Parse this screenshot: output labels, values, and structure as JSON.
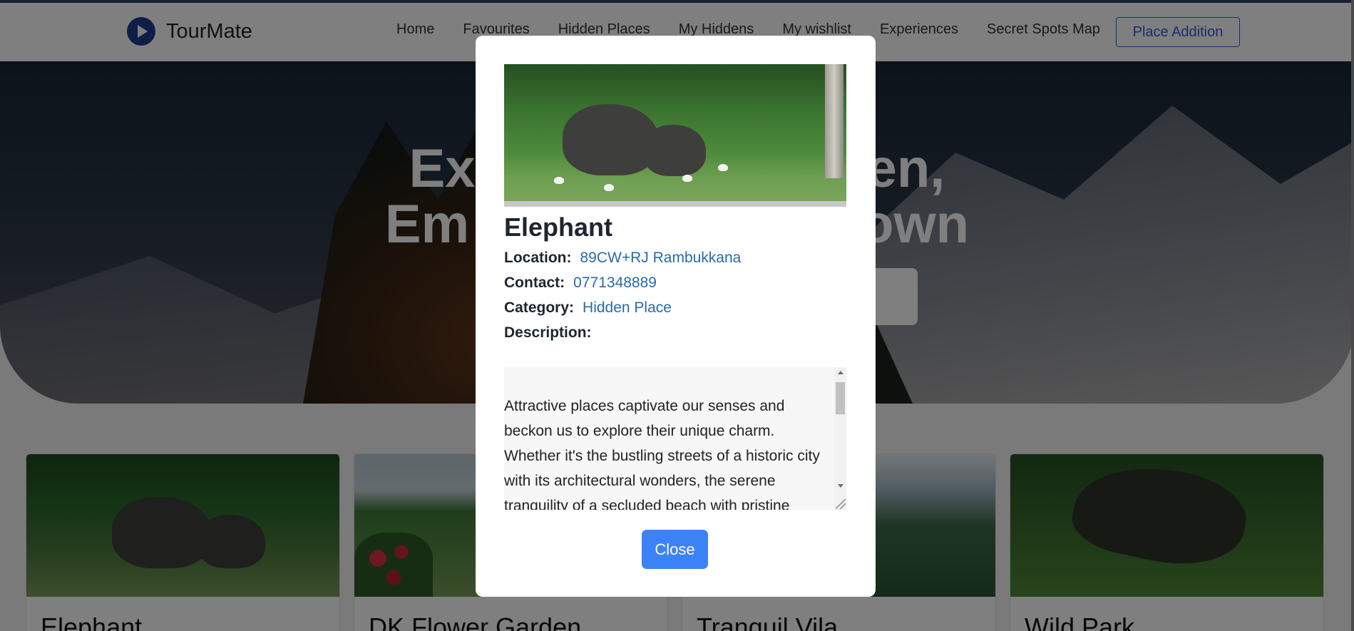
{
  "navbar": {
    "brand": "TourMate",
    "links": [
      "Home",
      "Favourites",
      "Hidden Places",
      "My Hiddens",
      "My wishlist",
      "Experiences",
      "Secret Spots Map"
    ],
    "cta": "Place Addition"
  },
  "hero": {
    "line1": "Ex                          en,",
    "line2": "Em                          own"
  },
  "cards": [
    {
      "title": "Elephant"
    },
    {
      "title": "DK Flower Garden"
    },
    {
      "title": "Tranquil Vila"
    },
    {
      "title": "Wild Park"
    }
  ],
  "modal": {
    "title": "Elephant",
    "location_label": "Location:",
    "location": "89CW+RJ Rambukkana",
    "contact_label": "Contact:",
    "contact": "0771348889",
    "category_label": "Category:",
    "category": "Hidden Place",
    "description_label": "Description:",
    "description": "Attractive places captivate our senses and beckon us to explore their unique charm. Whether it's the bustling streets of a historic city with its architectural wonders, the serene tranquility of a secluded beach with pristine",
    "close_label": "Close"
  },
  "colors": {
    "accent": "#3b82f6",
    "link": "#2a6aa8",
    "nav_cta": "#2f5bd6"
  }
}
